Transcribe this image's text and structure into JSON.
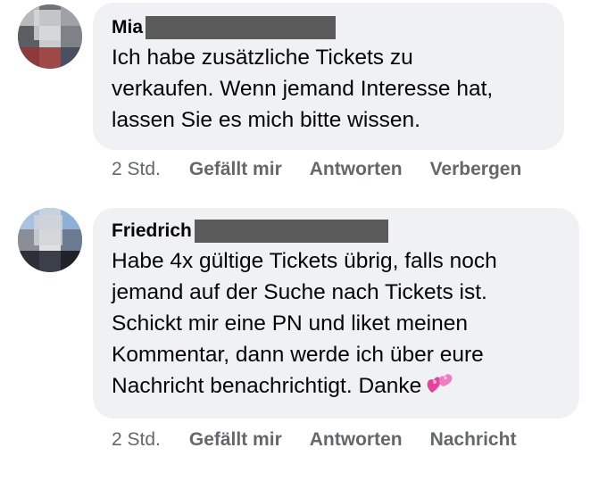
{
  "comments": [
    {
      "author": "Mia",
      "text": "Ich habe zusätzliche Tickets zu\nverkaufen. Wenn jemand Interesse hat,\nlassen Sie es mich bitte wissen.",
      "time": "2 Std.",
      "actions": [
        "Gefällt mir",
        "Antworten",
        "Verbergen"
      ]
    },
    {
      "author": "Friedrich",
      "text": "Habe 4x gültige Tickets übrig, falls noch\njemand auf der Suche nach Tickets ist.\nSchickt mir eine PN und liket meinen\nKommentar, dann werde ich über eure\nNachricht benachrichtigt. Danke",
      "emoji": "two-hearts-icon",
      "time": "2 Std.",
      "actions": [
        "Gefällt mir",
        "Antworten",
        "Nachricht"
      ]
    }
  ],
  "colors": {
    "bubble": "#eff1f5",
    "meta_text": "#65676b",
    "redaction": "#5a5a5a",
    "emoji": "#e8439c"
  }
}
